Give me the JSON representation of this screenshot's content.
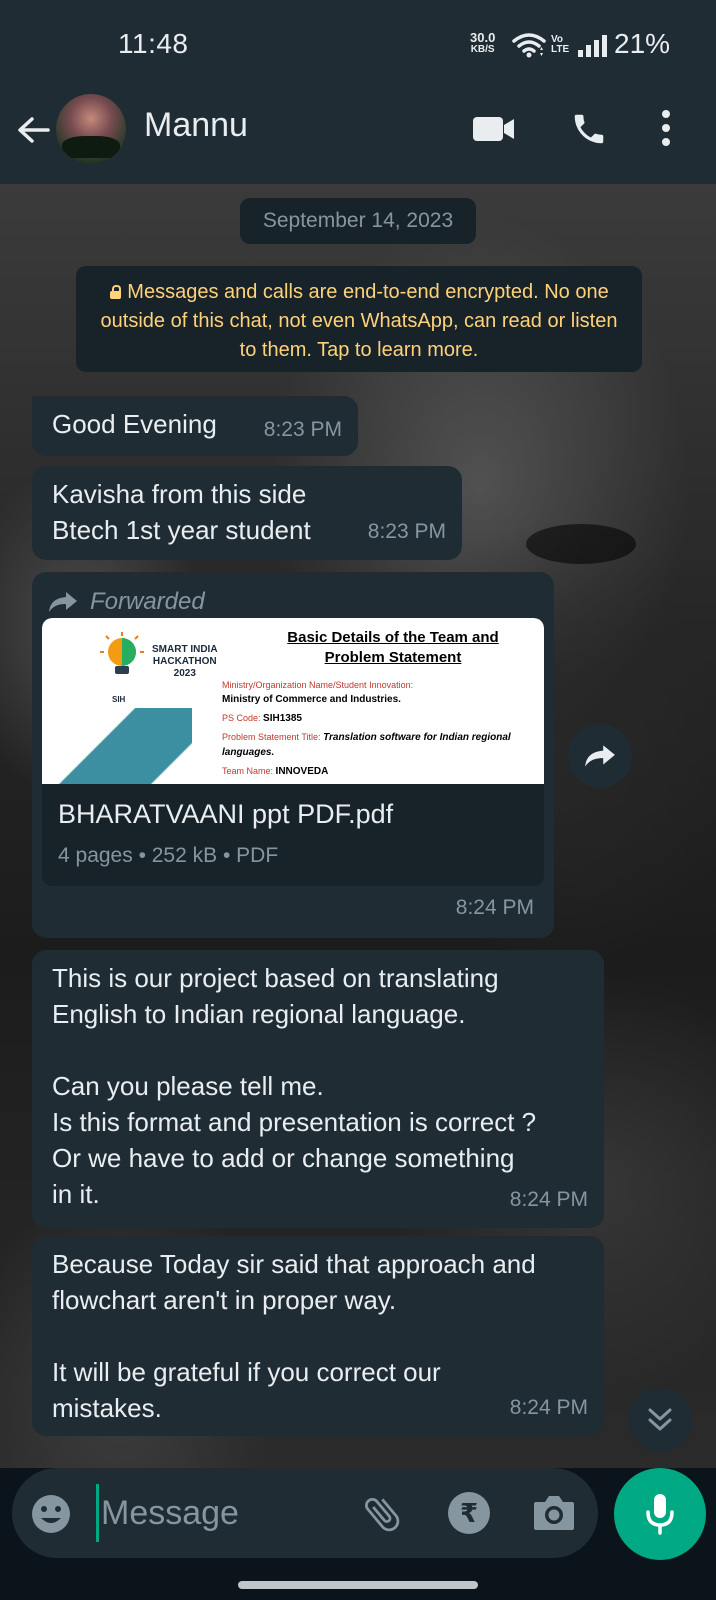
{
  "status_bar": {
    "time": "11:48",
    "net_speed_value": "30.0",
    "net_speed_unit": "KB/S",
    "volte_top": "Vo",
    "volte_bottom": "LTE",
    "battery": "21%"
  },
  "header": {
    "contact_name": "Mannu"
  },
  "chat": {
    "date_chip": "September 14, 2023",
    "encryption_notice": "Messages and calls are end-to-end encrypted. No one outside of this chat, not even WhatsApp, can read or listen to them. Tap to learn more.",
    "messages": [
      {
        "text": "Good Evening",
        "time": "8:23 PM"
      },
      {
        "text": "Kavisha from this side\nBtech 1st year student",
        "time": "8:23 PM"
      },
      {
        "forwarded_label": "Forwarded",
        "document": {
          "preview": {
            "logo_text": "SMART INDIA\nHACKATHON\n2023",
            "logo_badge": "SIH",
            "title": "Basic Details of the Team and Problem Statement",
            "ministry_label": "Ministry/Organization Name/Student Innovation:",
            "ministry_value": "Ministry of Commerce and Industries.",
            "ps_code_label": "PS Code:",
            "ps_code_value": "SIH1385",
            "ps_title_label": "Problem Statement Title:",
            "ps_title_value": "Translation software for Indian regional languages.",
            "team_name_label": "Team Name:",
            "team_name_value": "INNOVEDA"
          },
          "name": "BHARATVAANI ppt PDF.pdf",
          "meta": "4 pages • 252 kB • PDF"
        },
        "time": "8:24 PM"
      },
      {
        "text": "This is our project based on translating\nEnglish to Indian regional language.\n\nCan you please tell me.\nIs this format and presentation is correct ?\nOr we have to add or change something\nin it.",
        "time": "8:24 PM"
      },
      {
        "text": "Because Today sir said that approach and\nflowchart aren't in proper way.\n\nIt will be grateful if you correct our\nmistakes.",
        "time": "8:24 PM"
      }
    ]
  },
  "input": {
    "placeholder": "Message",
    "rupee_symbol": "₹"
  },
  "colors": {
    "header_bg": "#1f2c34",
    "bubble_bg": "#1f2c34",
    "accent_green": "#00a884",
    "notice_text": "#ffd279",
    "secondary_text": "#8696a0"
  },
  "icons": [
    "back-arrow-icon",
    "video-call-icon",
    "phone-icon",
    "more-vert-icon",
    "forward-icon",
    "chevron-double-down-icon",
    "emoji-icon",
    "paperclip-icon",
    "rupee-icon",
    "camera-icon",
    "mic-icon",
    "wifi-icon",
    "signal-icon",
    "lock-icon"
  ]
}
